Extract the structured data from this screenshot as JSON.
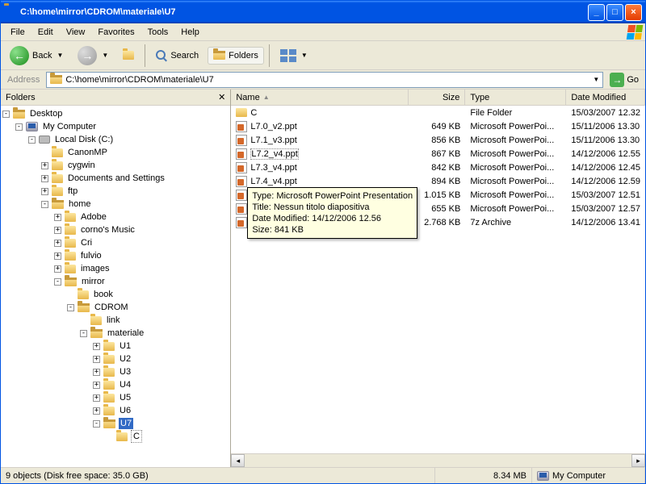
{
  "window": {
    "title": "C:\\home\\mirror\\CDROM\\materiale\\U7"
  },
  "menu": {
    "file": "File",
    "edit": "Edit",
    "view": "View",
    "favorites": "Favorites",
    "tools": "Tools",
    "help": "Help"
  },
  "toolbar": {
    "back": "Back",
    "search": "Search",
    "folders": "Folders"
  },
  "address": {
    "label": "Address",
    "value": "C:\\home\\mirror\\CDROM\\materiale\\U7",
    "go": "Go"
  },
  "leftpane": {
    "title": "Folders"
  },
  "tree": {
    "root": "Desktop",
    "mycomputer": "My Computer",
    "localc": "Local Disk (C:)",
    "items": [
      "CanonMP",
      "cygwin",
      "Documents and Settings",
      "ftp",
      "home"
    ],
    "home_children": [
      "Adobe",
      "corno's Music",
      "Cri",
      "fulvio",
      "images",
      "mirror"
    ],
    "mirror_children": [
      "book",
      "CDROM"
    ],
    "cdrom_children": [
      "link",
      "materiale"
    ],
    "materiale_children": [
      "U1",
      "U2",
      "U3",
      "U4",
      "U5",
      "U6",
      "U7"
    ],
    "u7_children": [
      "C"
    ]
  },
  "columns": {
    "name": "Name",
    "size": "Size",
    "type": "Type",
    "date": "Date Modified"
  },
  "files": [
    {
      "name": "C",
      "size": "",
      "type": "File Folder",
      "date": "15/03/2007 12.32",
      "icon": "folder"
    },
    {
      "name": "L7.0_v2.ppt",
      "size": "649 KB",
      "type": "Microsoft PowerPoi...",
      "date": "15/11/2006 13.30",
      "icon": "ppt"
    },
    {
      "name": "L7.1_v3.ppt",
      "size": "856 KB",
      "type": "Microsoft PowerPoi...",
      "date": "15/11/2006 13.30",
      "icon": "ppt"
    },
    {
      "name": "L7.2_v4.ppt",
      "size": "867 KB",
      "type": "Microsoft PowerPoi...",
      "date": "14/12/2006 12.55",
      "icon": "ppt",
      "selected": true
    },
    {
      "name": "L7.3_v4.ppt",
      "size": "842 KB",
      "type": "Microsoft PowerPoi...",
      "date": "14/12/2006 12.45",
      "icon": "ppt"
    },
    {
      "name": "L7.4_v4.ppt",
      "size": "894 KB",
      "type": "Microsoft PowerPoi...",
      "date": "14/12/2006 12.59",
      "icon": "ppt"
    },
    {
      "name": "",
      "size": "1.015 KB",
      "type": "Microsoft PowerPoi...",
      "date": "15/03/2007 12.51",
      "icon": "ppt"
    },
    {
      "name": "",
      "size": "655 KB",
      "type": "Microsoft PowerPoi...",
      "date": "15/03/2007 12.57",
      "icon": "ppt"
    },
    {
      "name": "",
      "size": "2.768 KB",
      "type": "7z Archive",
      "date": "14/12/2006 13.41",
      "icon": "ppt"
    }
  ],
  "tooltip": {
    "l1": "Type: Microsoft PowerPoint Presentation",
    "l2": "Title: Nessun titolo diapositiva",
    "l3": "Date Modified: 14/12/2006 12.56",
    "l4": "Size: 841 KB"
  },
  "statusbar": {
    "objects": "9 objects (Disk free space: 35.0 GB)",
    "size": "8.34 MB",
    "location": "My Computer"
  }
}
